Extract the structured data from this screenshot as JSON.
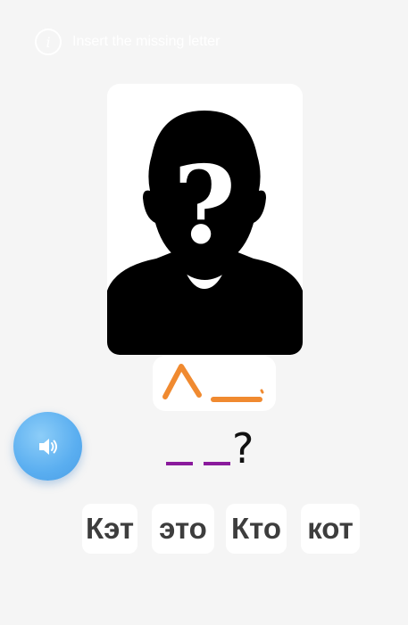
{
  "instruction": {
    "icon": "info-icon",
    "text": "Insert the missing letter"
  },
  "picture": {
    "icon": "unknown-person-question-icon",
    "description_symbol": "?"
  },
  "answer": {
    "blanks_count": 2,
    "question_mark": "?",
    "blank_color": "#8a1a9c"
  },
  "audio_button": {
    "icon": "speaker-icon",
    "color": "#5aaef0"
  },
  "options": [
    {
      "label": "Кэт"
    },
    {
      "label": "это"
    },
    {
      "label": "Кто"
    },
    {
      "label": "кот"
    }
  ],
  "colors": {
    "background": "#f5f5f5",
    "handwriting": "#f08a30",
    "option_text": "#3d3d3d"
  }
}
